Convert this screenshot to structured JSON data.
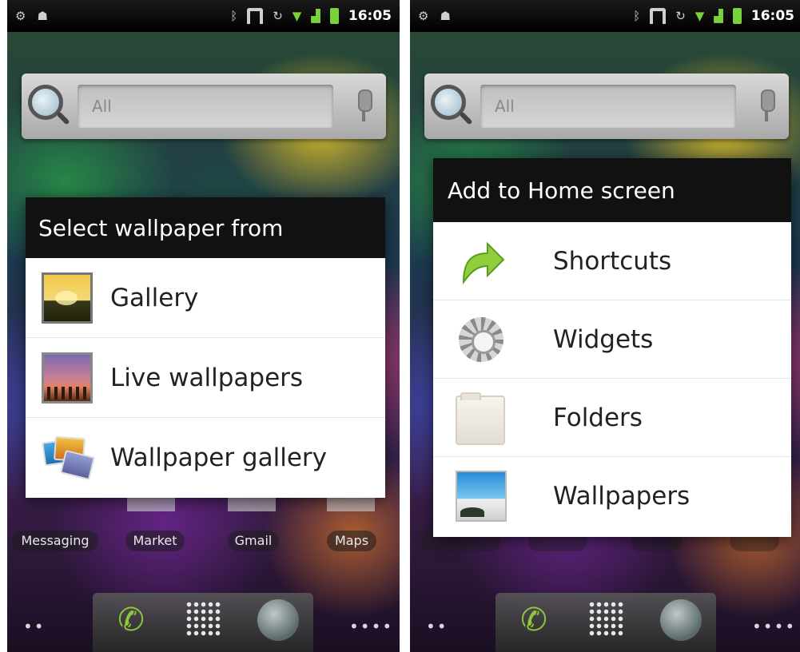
{
  "screens": [
    {
      "status_bar": {
        "time": "16:05",
        "icons": [
          "settings-icon",
          "android-icon",
          "bluetooth-icon",
          "usb-icon",
          "sync-icon",
          "wifi-icon",
          "signal-icon",
          "battery-icon"
        ]
      },
      "search": {
        "placeholder": "All"
      },
      "dialog": {
        "title": "Select wallpaper from",
        "items": [
          {
            "label": "Gallery",
            "icon": "gallery-icon"
          },
          {
            "label": "Live wallpapers",
            "icon": "live-wallpapers-icon"
          },
          {
            "label": "Wallpaper gallery",
            "icon": "wallpaper-gallery-icon"
          }
        ]
      },
      "apps": [
        "Messaging",
        "Market",
        "Gmail",
        "Maps"
      ],
      "dock": {
        "left_dots": "••",
        "right_dots": "••••"
      }
    },
    {
      "status_bar": {
        "time": "16:05",
        "icons": [
          "settings-icon",
          "android-icon",
          "bluetooth-icon",
          "usb-icon",
          "sync-icon",
          "wifi-icon",
          "signal-icon",
          "battery-icon"
        ]
      },
      "search": {
        "placeholder": "All"
      },
      "dialog": {
        "title": "Add to Home screen",
        "items": [
          {
            "label": "Shortcuts",
            "icon": "shortcut-arrow-icon"
          },
          {
            "label": "Widgets",
            "icon": "widgets-gear-icon"
          },
          {
            "label": "Folders",
            "icon": "folder-icon"
          },
          {
            "label": "Wallpapers",
            "icon": "wallpapers-icon"
          }
        ]
      },
      "dock": {
        "left_dots": "••",
        "right_dots": "••••"
      }
    }
  ],
  "colors": {
    "dialog_title_bg": "#111111",
    "status_accent": "#7ad13a",
    "dock_phone": "#8ec83a"
  }
}
